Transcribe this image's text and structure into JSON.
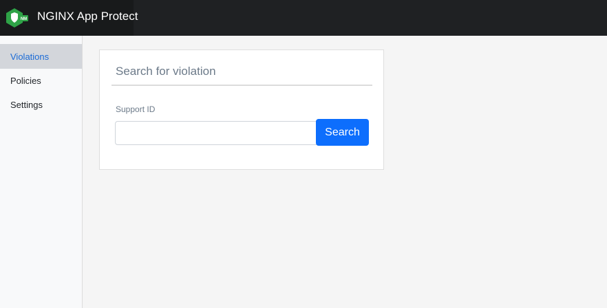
{
  "app": {
    "title": "NGINX App Protect",
    "logo_icon": "nginx-app-protect-shield-icon",
    "logo_text": "NM",
    "brand_green": "#2ea347"
  },
  "sidebar": {
    "items": [
      {
        "label": "Violations",
        "active": true
      },
      {
        "label": "Policies",
        "active": false
      },
      {
        "label": "Settings",
        "active": false
      }
    ]
  },
  "search_card": {
    "title": "Search for violation",
    "field_label": "Support ID",
    "input_value": "",
    "input_placeholder": "",
    "button_label": "Search"
  },
  "colors": {
    "accent": "#0d6efd",
    "topbar": "#1f2123",
    "active_nav_text": "#1a6ad6"
  }
}
